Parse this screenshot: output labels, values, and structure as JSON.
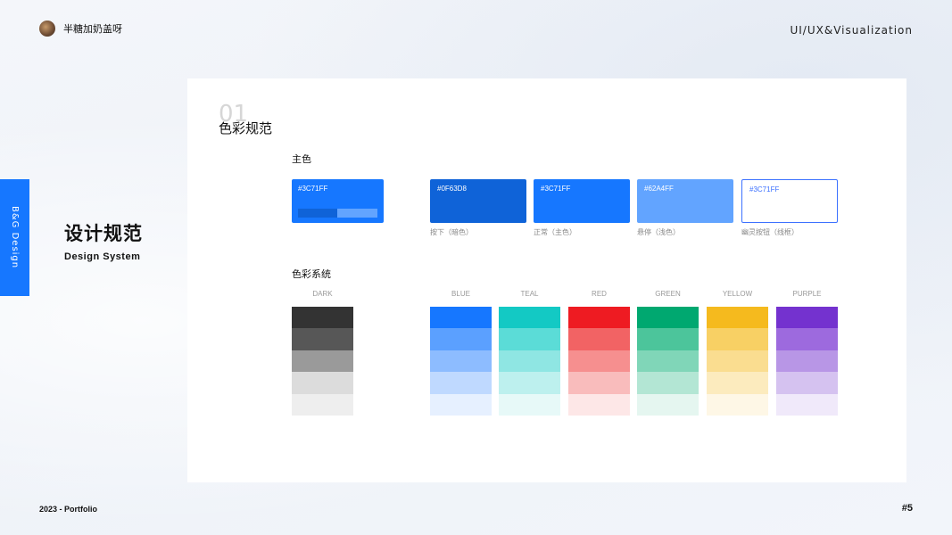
{
  "author": {
    "name": "半糖加奶盖呀"
  },
  "header": {
    "category": "UI/UX&Visualization"
  },
  "side_tab": {
    "label": "B&G Design"
  },
  "section": {
    "title": "设计规范",
    "subtitle": "Design System"
  },
  "footer": {
    "left": "2023 - Portfolio",
    "page": "#5"
  },
  "card": {
    "number": "01",
    "title": "色彩规范",
    "primary_label": "主色",
    "primary": {
      "hex": "#3C71FF",
      "color": "#1677ff",
      "bar_left": "#0f63d8",
      "bar_right": "#62a4ff"
    },
    "states": [
      {
        "hex": "#0F63D8",
        "color": "#0f63d8",
        "caption": "按下（暗色）"
      },
      {
        "hex": "#3C71FF",
        "color": "#1677ff",
        "caption": "正常（主色）"
      },
      {
        "hex": "#62A4FF",
        "color": "#62a4ff",
        "caption": "悬停（浅色）"
      },
      {
        "hex": "#3C71FF",
        "color": "#ffffff",
        "caption": "幽灵按钮（线框）"
      }
    ],
    "system_label": "色彩系统",
    "palette": [
      {
        "name": "DARK",
        "shades": [
          "#333333",
          "#575757",
          "#9a9a9a",
          "#dcdcdc",
          "#eeeeee"
        ]
      },
      {
        "name": "BLUE",
        "shades": [
          "#1677ff",
          "#5ba0ff",
          "#8dbcff",
          "#bfd9ff",
          "#e6f0ff"
        ]
      },
      {
        "name": "TEAL",
        "shades": [
          "#13c9c4",
          "#5bdcd7",
          "#8fe6e3",
          "#bdf0ee",
          "#e7f9f8"
        ]
      },
      {
        "name": "RED",
        "shades": [
          "#ee1b22",
          "#f26364",
          "#f68f8f",
          "#f9bcbc",
          "#fde7e7"
        ]
      },
      {
        "name": "GREEN",
        "shades": [
          "#00a870",
          "#4cc59b",
          "#80d6b8",
          "#b3e6d4",
          "#e5f6f0"
        ]
      },
      {
        "name": "YELLOW",
        "shades": [
          "#f5ba1e",
          "#f8d064",
          "#fadd90",
          "#fcebbe",
          "#fef7e6"
        ]
      },
      {
        "name": "PURPLE",
        "shades": [
          "#7432cf",
          "#9d6ade",
          "#b896e6",
          "#d5c2f0",
          "#f0e9fa"
        ]
      }
    ]
  }
}
